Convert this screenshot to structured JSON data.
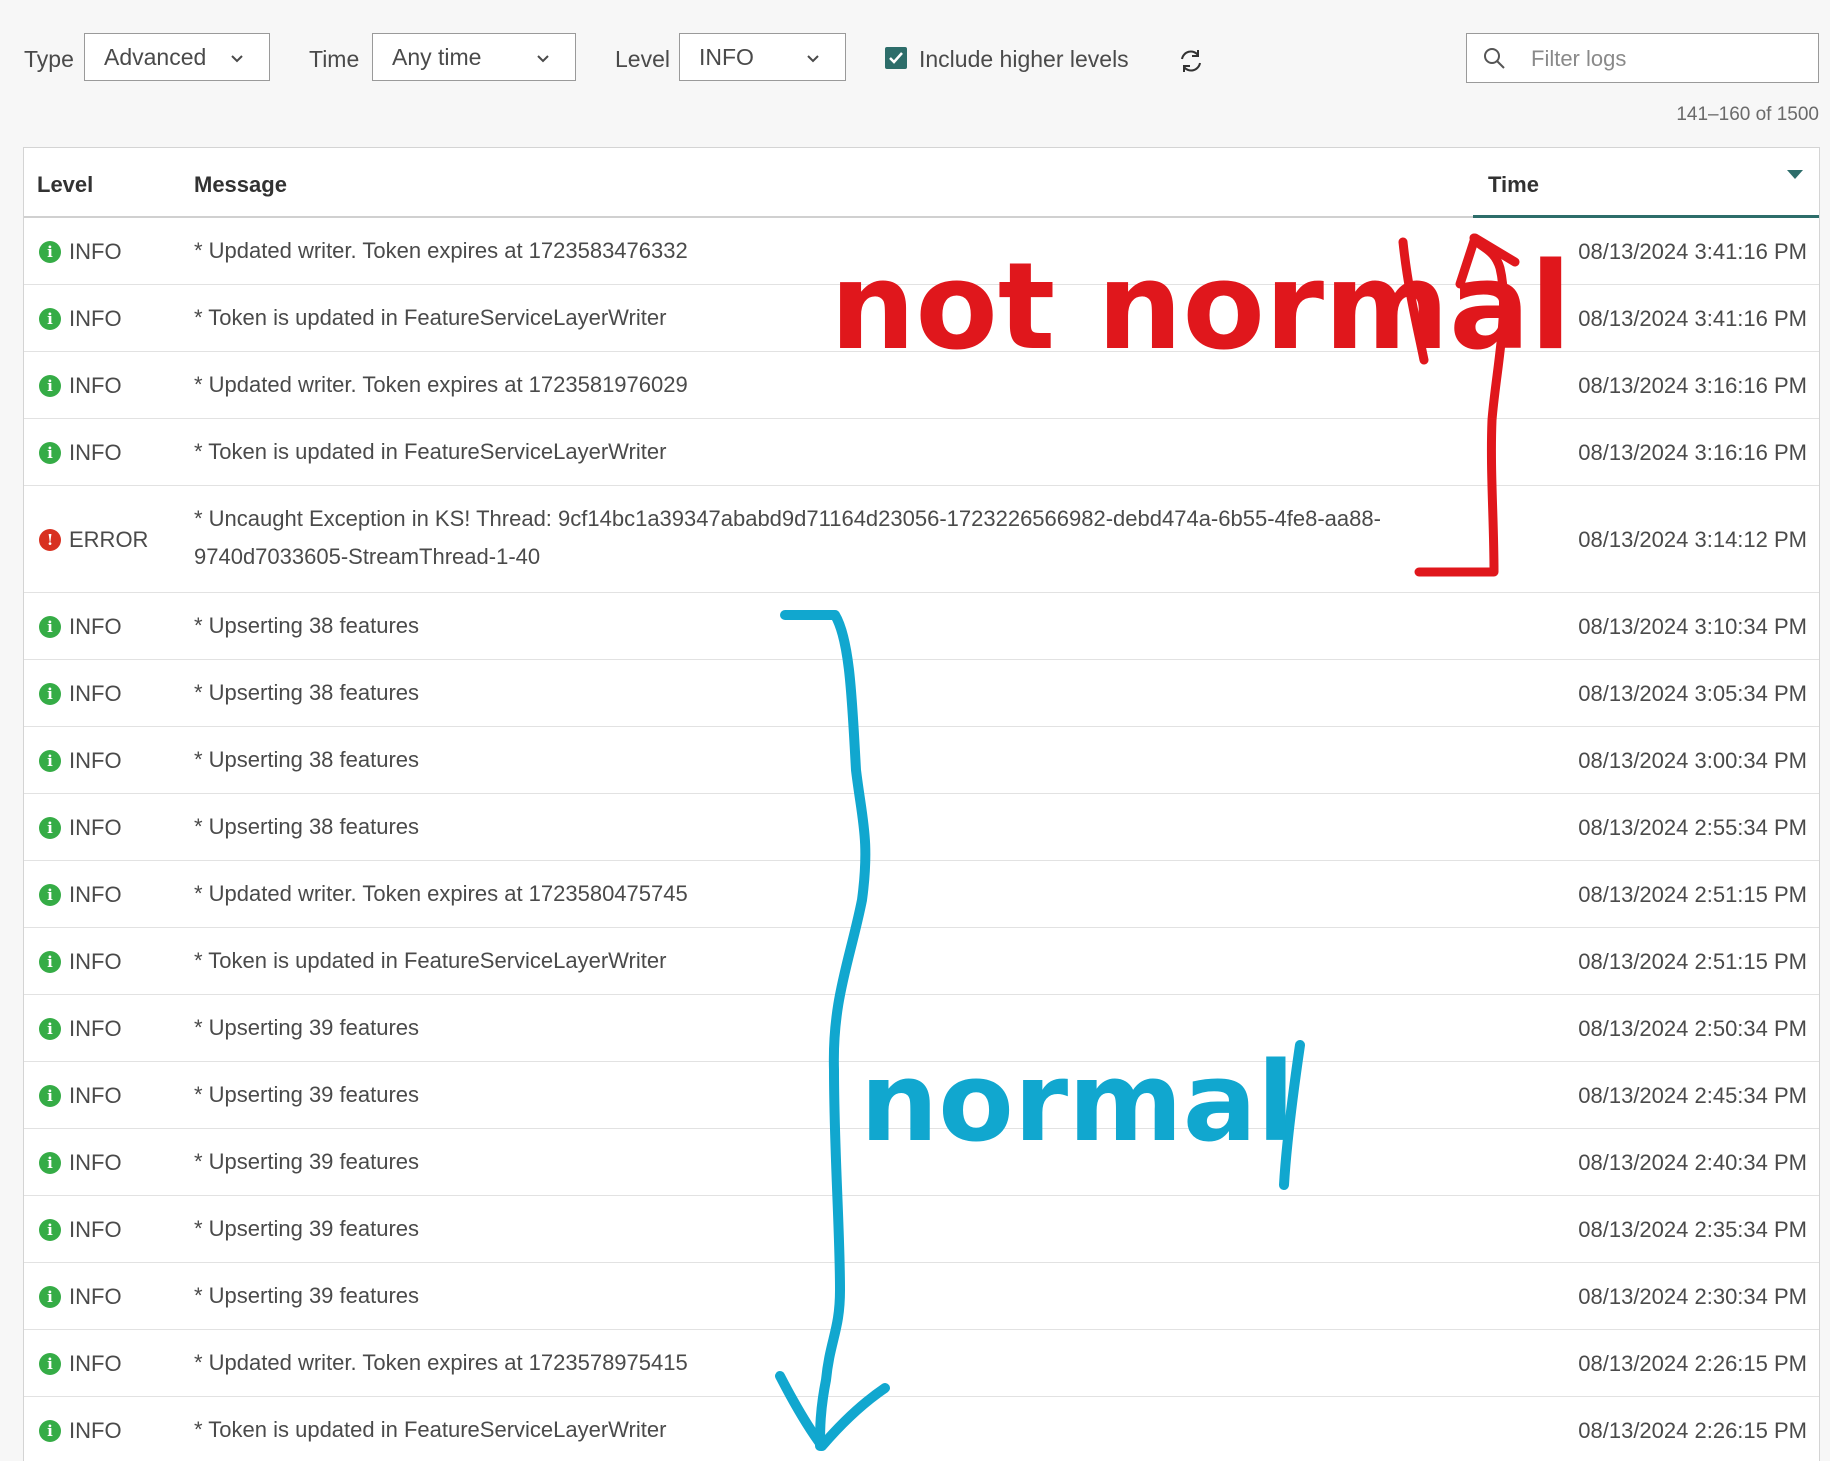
{
  "toolbar": {
    "type_label": "Type",
    "type_value": "Advanced",
    "time_label": "Time",
    "time_value": "Any time",
    "level_label": "Level",
    "level_value": "INFO",
    "include_higher_label": "Include higher levels",
    "include_higher_checked": true,
    "search_placeholder": "Filter logs"
  },
  "pagination": "141–160 of 1500",
  "table": {
    "columns": {
      "level": "Level",
      "message": "Message",
      "time": "Time"
    },
    "sort": "time-descending",
    "rows": [
      {
        "level": "INFO",
        "message": "* Updated writer. Token expires at 1723583476332",
        "time": "08/13/2024 3:41:16 PM"
      },
      {
        "level": "INFO",
        "message": "* Token is updated in FeatureServiceLayerWriter",
        "time": "08/13/2024 3:41:16 PM"
      },
      {
        "level": "INFO",
        "message": "* Updated writer. Token expires at 1723581976029",
        "time": "08/13/2024 3:16:16 PM"
      },
      {
        "level": "INFO",
        "message": "* Token is updated in FeatureServiceLayerWriter",
        "time": "08/13/2024 3:16:16 PM"
      },
      {
        "level": "ERROR",
        "message": "* Uncaught Exception in KS! Thread: 9cf14bc1a39347ababd9d71164d23056-1723226566982-debd474a-6b55-4fe8-aa88-9740d7033605-StreamThread-1-40",
        "time": "08/13/2024 3:14:12 PM"
      },
      {
        "level": "INFO",
        "message": "* Upserting 38 features",
        "time": "08/13/2024 3:10:34 PM"
      },
      {
        "level": "INFO",
        "message": "* Upserting 38 features",
        "time": "08/13/2024 3:05:34 PM"
      },
      {
        "level": "INFO",
        "message": "* Upserting 38 features",
        "time": "08/13/2024 3:00:34 PM"
      },
      {
        "level": "INFO",
        "message": "* Upserting 38 features",
        "time": "08/13/2024 2:55:34 PM"
      },
      {
        "level": "INFO",
        "message": "* Updated writer. Token expires at 1723580475745",
        "time": "08/13/2024 2:51:15 PM"
      },
      {
        "level": "INFO",
        "message": "* Token is updated in FeatureServiceLayerWriter",
        "time": "08/13/2024 2:51:15 PM"
      },
      {
        "level": "INFO",
        "message": "* Upserting 39 features",
        "time": "08/13/2024 2:50:34 PM"
      },
      {
        "level": "INFO",
        "message": "* Upserting 39 features",
        "time": "08/13/2024 2:45:34 PM"
      },
      {
        "level": "INFO",
        "message": "* Upserting 39 features",
        "time": "08/13/2024 2:40:34 PM"
      },
      {
        "level": "INFO",
        "message": "* Upserting 39 features",
        "time": "08/13/2024 2:35:34 PM"
      },
      {
        "level": "INFO",
        "message": "* Upserting 39 features",
        "time": "08/13/2024 2:30:34 PM"
      },
      {
        "level": "INFO",
        "message": "* Updated writer. Token expires at 1723578975415",
        "time": "08/13/2024 2:26:15 PM"
      },
      {
        "level": "INFO",
        "message": "* Token is updated in FeatureServiceLayerWriter",
        "time": "08/13/2024 2:26:15 PM"
      }
    ]
  },
  "annotations": {
    "red_text": "not normal",
    "red_color": "#e0171c",
    "blue_text": "normal",
    "blue_color": "#11a7cf"
  },
  "colors": {
    "accent": "#2d6d6a",
    "info": "#35ac46",
    "error": "#d83020"
  }
}
